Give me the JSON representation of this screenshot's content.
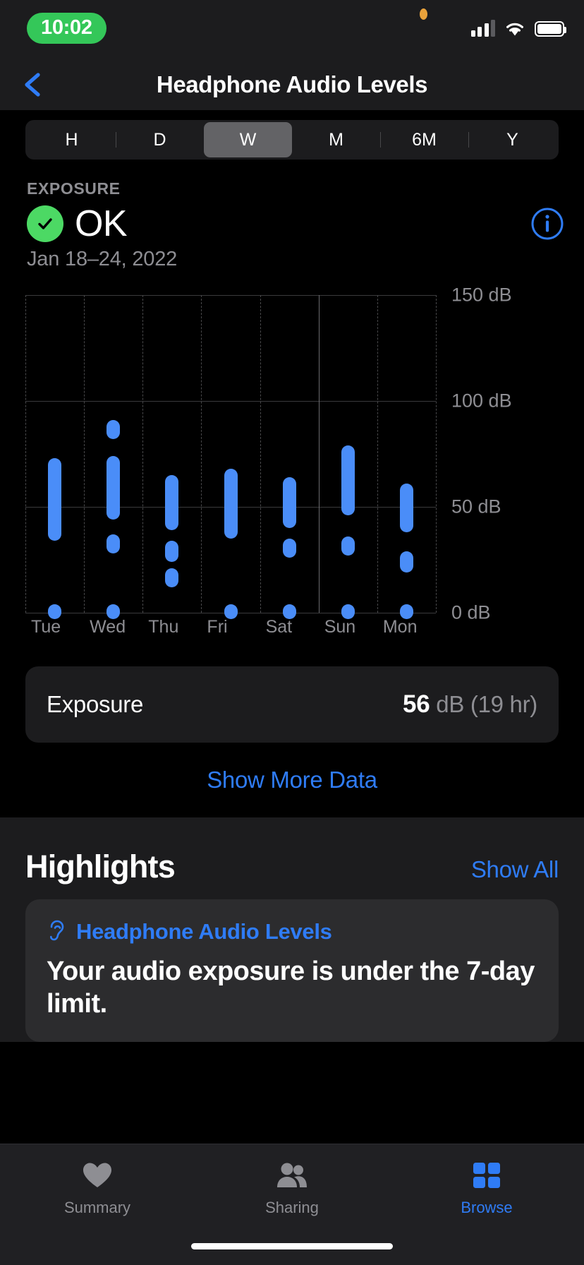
{
  "status_bar": {
    "time": "10:02",
    "recording_indicator": true,
    "icons": [
      "cellular-signal-icon",
      "wifi-icon",
      "battery-icon"
    ]
  },
  "nav": {
    "back_icon": "chevron-left-icon",
    "title": "Headphone Audio Levels"
  },
  "segmented_control": {
    "options": [
      "H",
      "D",
      "W",
      "M",
      "6M",
      "Y"
    ],
    "selected": "W"
  },
  "exposure_header": {
    "label": "EXPOSURE",
    "status": "OK",
    "status_color": "#4cd964",
    "check_icon": "checkmark-circle-icon",
    "info_icon": "info-circle-icon",
    "date_range": "Jan 18–24, 2022"
  },
  "chart_data": {
    "type": "bar",
    "title": "Headphone Audio Levels",
    "subtitle": "Jan 18–24, 2022",
    "xlabel": "",
    "ylabel": "dB",
    "ylim": [
      0,
      150
    ],
    "yticks": [
      0,
      50,
      100,
      150
    ],
    "ytick_labels": [
      "0 dB",
      "50 dB",
      "100 dB",
      "150 dB"
    ],
    "grid": true,
    "accent_color": "#4a8df8",
    "categories": [
      "Tue",
      "Wed",
      "Thu",
      "Fri",
      "Sat",
      "Sun",
      "Mon"
    ],
    "note": "Each day shows one or more vertical range bars (min–max dB) plus a baseline 0 dB marker",
    "ranges": [
      {
        "day": "Tue",
        "bars": [
          [
            37,
            70
          ],
          [
            0,
            1
          ]
        ]
      },
      {
        "day": "Wed",
        "bars": [
          [
            85,
            88
          ],
          [
            47,
            71
          ],
          [
            31,
            34
          ],
          [
            0,
            1
          ]
        ]
      },
      {
        "day": "Thu",
        "bars": [
          [
            42,
            62
          ],
          [
            27,
            31
          ],
          [
            15,
            18
          ]
        ]
      },
      {
        "day": "Fri",
        "bars": [
          [
            38,
            65
          ],
          [
            0,
            1
          ]
        ]
      },
      {
        "day": "Sat",
        "bars": [
          [
            43,
            61
          ],
          [
            29,
            32
          ],
          [
            0,
            1
          ]
        ]
      },
      {
        "day": "Sun",
        "bars": [
          [
            49,
            76
          ],
          [
            30,
            33
          ],
          [
            0,
            1
          ]
        ]
      },
      {
        "day": "Mon",
        "bars": [
          [
            41,
            58
          ],
          [
            22,
            26
          ],
          [
            0,
            1
          ]
        ]
      }
    ]
  },
  "exposure_card": {
    "label": "Exposure",
    "value": "56",
    "unit": "dB (19 hr)"
  },
  "show_more": "Show More Data",
  "highlights": {
    "title": "Highlights",
    "show_all": "Show All",
    "card": {
      "icon": "ear-icon",
      "title": "Headphone Audio Levels",
      "body": "Your audio exposure is under the 7-day limit."
    }
  },
  "tab_bar": {
    "items": [
      {
        "label": "Summary",
        "icon": "heart-icon",
        "active": false
      },
      {
        "label": "Sharing",
        "icon": "people-icon",
        "active": false
      },
      {
        "label": "Browse",
        "icon": "grid-icon",
        "active": true
      }
    ]
  }
}
